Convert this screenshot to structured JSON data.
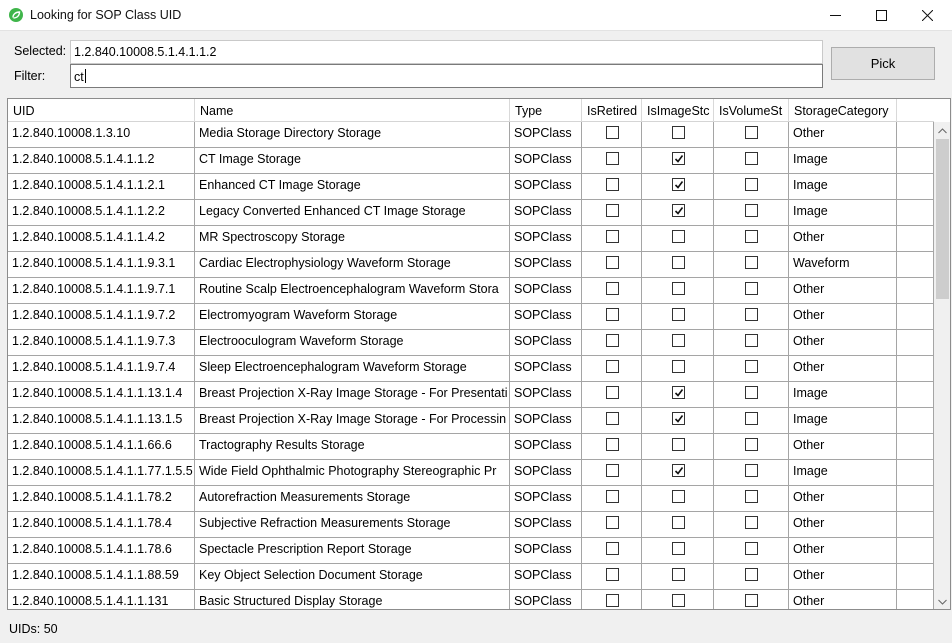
{
  "window": {
    "title": "Looking for SOP Class UID"
  },
  "form": {
    "selected_label": "Selected:",
    "selected_value": "1.2.840.10008.5.1.4.1.1.2",
    "filter_label": "Filter:",
    "filter_value": "ct",
    "pick_label": "Pick"
  },
  "table": {
    "columns": [
      "UID",
      "Name",
      "Type",
      "IsRetired",
      "IsImageStc",
      "IsVolumeSt",
      "StorageCategory"
    ],
    "rows": [
      {
        "uid": "1.2.840.10008.1.3.10",
        "name": "Media Storage Directory Storage",
        "type": "SOPClass",
        "retired": false,
        "image": false,
        "volume": false,
        "category": "Other"
      },
      {
        "uid": "1.2.840.10008.5.1.4.1.1.2",
        "name": "CT Image Storage",
        "type": "SOPClass",
        "retired": false,
        "image": true,
        "volume": false,
        "category": "Image"
      },
      {
        "uid": "1.2.840.10008.5.1.4.1.1.2.1",
        "name": "Enhanced CT Image Storage",
        "type": "SOPClass",
        "retired": false,
        "image": true,
        "volume": false,
        "category": "Image"
      },
      {
        "uid": "1.2.840.10008.5.1.4.1.1.2.2",
        "name": "Legacy Converted Enhanced CT Image Storage",
        "type": "SOPClass",
        "retired": false,
        "image": true,
        "volume": false,
        "category": "Image"
      },
      {
        "uid": "1.2.840.10008.5.1.4.1.1.4.2",
        "name": "MR Spectroscopy Storage",
        "type": "SOPClass",
        "retired": false,
        "image": false,
        "volume": false,
        "category": "Other"
      },
      {
        "uid": "1.2.840.10008.5.1.4.1.1.9.3.1",
        "name": "Cardiac Electrophysiology Waveform Storage",
        "type": "SOPClass",
        "retired": false,
        "image": false,
        "volume": false,
        "category": "Waveform"
      },
      {
        "uid": "1.2.840.10008.5.1.4.1.1.9.7.1",
        "name": "Routine Scalp Electroencephalogram Waveform Stora",
        "type": "SOPClass",
        "retired": false,
        "image": false,
        "volume": false,
        "category": "Other"
      },
      {
        "uid": "1.2.840.10008.5.1.4.1.1.9.7.2",
        "name": "Electromyogram Waveform Storage",
        "type": "SOPClass",
        "retired": false,
        "image": false,
        "volume": false,
        "category": "Other"
      },
      {
        "uid": "1.2.840.10008.5.1.4.1.1.9.7.3",
        "name": "Electrooculogram Waveform Storage",
        "type": "SOPClass",
        "retired": false,
        "image": false,
        "volume": false,
        "category": "Other"
      },
      {
        "uid": "1.2.840.10008.5.1.4.1.1.9.7.4",
        "name": "Sleep Electroencephalogram Waveform Storage",
        "type": "SOPClass",
        "retired": false,
        "image": false,
        "volume": false,
        "category": "Other"
      },
      {
        "uid": "1.2.840.10008.5.1.4.1.1.13.1.4",
        "name": "Breast Projection X-Ray Image Storage - For Presentati",
        "type": "SOPClass",
        "retired": false,
        "image": true,
        "volume": false,
        "category": "Image"
      },
      {
        "uid": "1.2.840.10008.5.1.4.1.1.13.1.5",
        "name": "Breast Projection X-Ray Image Storage - For Processin",
        "type": "SOPClass",
        "retired": false,
        "image": true,
        "volume": false,
        "category": "Image"
      },
      {
        "uid": "1.2.840.10008.5.1.4.1.1.66.6",
        "name": "Tractography Results Storage",
        "type": "SOPClass",
        "retired": false,
        "image": false,
        "volume": false,
        "category": "Other"
      },
      {
        "uid": "1.2.840.10008.5.1.4.1.1.77.1.5.5",
        "name": "Wide Field Ophthalmic Photography Stereographic Pr",
        "type": "SOPClass",
        "retired": false,
        "image": true,
        "volume": false,
        "category": "Image"
      },
      {
        "uid": "1.2.840.10008.5.1.4.1.1.78.2",
        "name": "Autorefraction Measurements Storage",
        "type": "SOPClass",
        "retired": false,
        "image": false,
        "volume": false,
        "category": "Other"
      },
      {
        "uid": "1.2.840.10008.5.1.4.1.1.78.4",
        "name": "Subjective Refraction Measurements Storage",
        "type": "SOPClass",
        "retired": false,
        "image": false,
        "volume": false,
        "category": "Other"
      },
      {
        "uid": "1.2.840.10008.5.1.4.1.1.78.6",
        "name": "Spectacle Prescription Report Storage",
        "type": "SOPClass",
        "retired": false,
        "image": false,
        "volume": false,
        "category": "Other"
      },
      {
        "uid": "1.2.840.10008.5.1.4.1.1.88.59",
        "name": "Key Object Selection Document Storage",
        "type": "SOPClass",
        "retired": false,
        "image": false,
        "volume": false,
        "category": "Other"
      },
      {
        "uid": "1.2.840.10008.5.1.4.1.1.131",
        "name": "Basic Structured Display Storage",
        "type": "SOPClass",
        "retired": false,
        "image": false,
        "volume": false,
        "category": "Other"
      }
    ]
  },
  "status": {
    "text": "UIDs: 50"
  },
  "icons": {
    "app": "app-leaf-icon",
    "minimize": "minimize-icon",
    "maximize": "maximize-icon",
    "close": "close-icon",
    "check": "check-icon"
  },
  "colors": {
    "app_icon": "#3fb54a",
    "grid_line": "#a5a5a5"
  }
}
